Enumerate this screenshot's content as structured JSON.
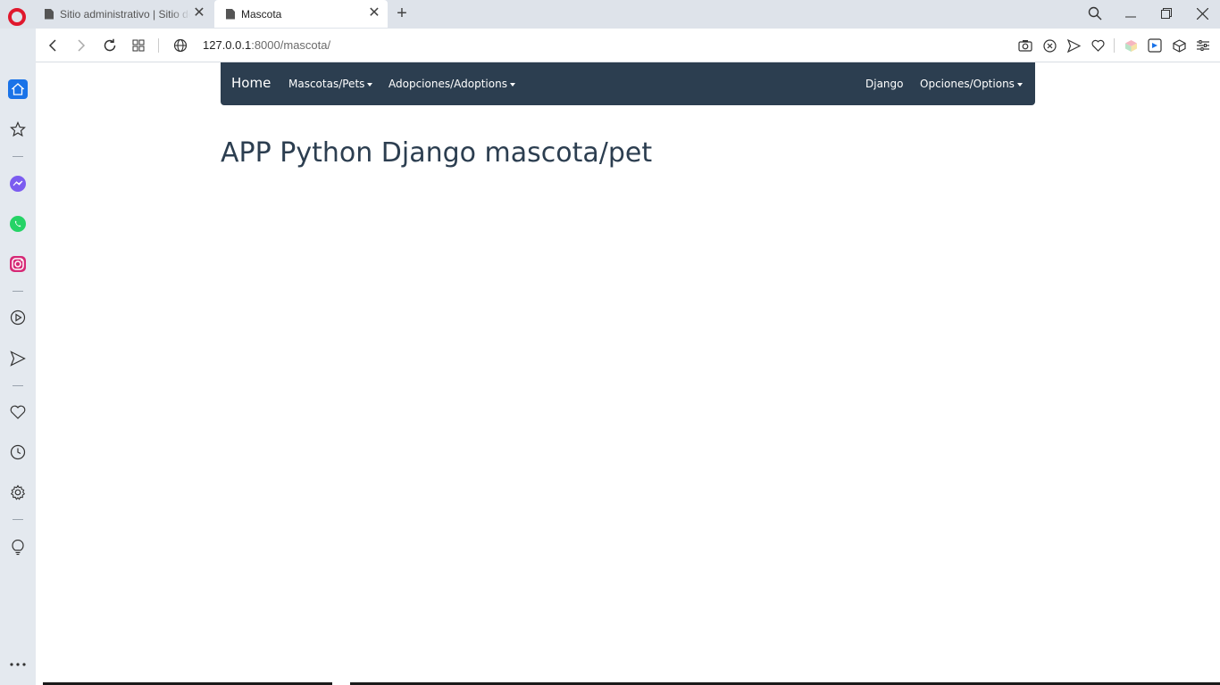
{
  "browser": {
    "tabs": [
      {
        "title": "Sitio administrativo | Sitio de administración de Django"
      },
      {
        "title": "Mascota"
      }
    ],
    "url": {
      "host": "127.0.0.1",
      "rest": ":8000/mascota/"
    }
  },
  "site": {
    "brand": "Home",
    "nav_left": [
      "Mascotas/Pets",
      "Adopciones/Adoptions"
    ],
    "nav_right": [
      "Django",
      "Opciones/Options"
    ],
    "heading": "APP Python Django mascota/pet"
  },
  "colors": {
    "navbar_bg": "#2c3e50",
    "heading": "#2c3e50",
    "opera_red": "#e0182d",
    "sidebar_active": "#1a73e8"
  }
}
